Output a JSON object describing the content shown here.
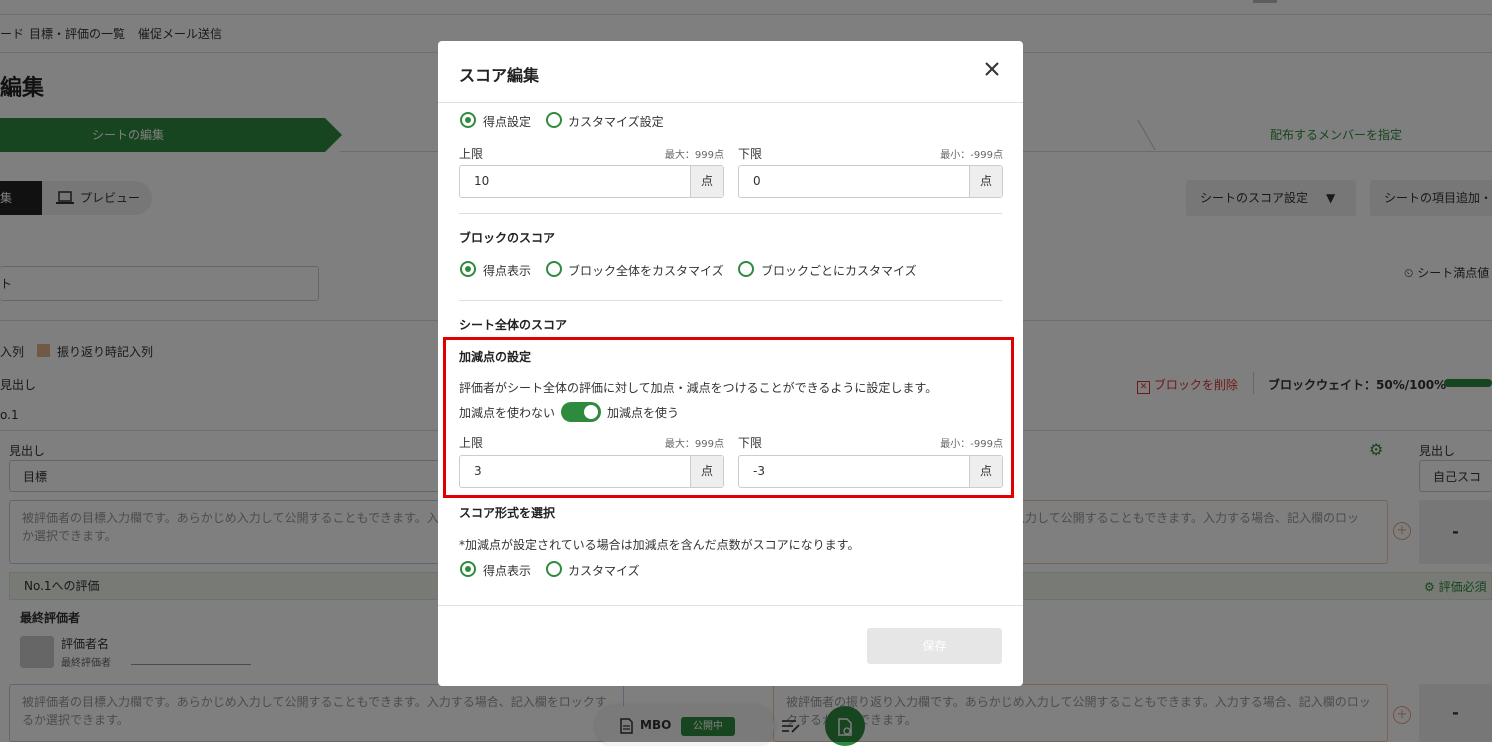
{
  "background": {
    "nav_items": [
      "ード",
      "目標・評価の一覧",
      "催促メール送信"
    ],
    "page_title": "編集",
    "steps": {
      "active": "シートの編集",
      "last": "配布するメンバーを指定"
    },
    "tabs": {
      "edit": "集",
      "preview": "プレビュー"
    },
    "buttons": {
      "score_settings": "シートのスコア設定",
      "add_items": "シートの項目追加・"
    },
    "input_fragment": "ト",
    "satisfy_label": "シート満点値",
    "legend": {
      "left": "入列",
      "reflection": "振り返り時記入列"
    },
    "heading_label": "見出し",
    "no1_label": "o.1",
    "delete_block": "ブロックを削除",
    "block_weight": "ブロックウェイト：50%/100%",
    "field_heading": "見出し",
    "field_goal": "目標",
    "field_heading_right": "見出し",
    "field_self_score": "自己スコア",
    "textarea_left": "被評価者の目標入力欄です。あらかじめ入力して公開することもできます。入力する場合、記入欄のロックるか選択できます。",
    "textarea_right": "入力して公開することもできます。入力する場合、記入欄のロッ",
    "dash": "-",
    "eval_band": "No.1への評価",
    "eval_required": "評価必須",
    "final_evaluator": "最終評価者",
    "evaluator_name": "評価者名",
    "evaluator_role": "最終評価者",
    "textarea_bottom_left": "被評価者の目標入力欄です。あらかじめ入力して公開することもできます。入力する場合、記入欄をロックするか選択できます。",
    "textarea_bottom_right": "被評価者の振り返り入力欄です。あらかじめ入力して公開することもできます。入力する場合、記入欄のロックするか選択できます。",
    "bottom_bar": {
      "label": "MBO",
      "status": "公開中"
    }
  },
  "modal": {
    "title": "スコア編集",
    "top_radios": {
      "options": [
        "得点設定",
        "カスタマイズ設定"
      ],
      "selected": 0
    },
    "range1": {
      "upper_label": "上限",
      "upper_hint": "最大：999点",
      "upper_value": "10",
      "unit": "点",
      "lower_label": "下限",
      "lower_hint": "最小：-999点",
      "lower_value": "0"
    },
    "block_score": {
      "title": "ブロックのスコア",
      "options": [
        "得点表示",
        "ブロック全体をカスタマイズ",
        "ブロックごとにカスタマイズ"
      ],
      "selected": 0
    },
    "sheet_score_title": "シート全体のスコア",
    "adjust": {
      "title": "加減点の設定",
      "description": "評価者がシート全体の評価に対して加点・減点をつけることができるように設定します。",
      "off_label": "加減点を使わない",
      "on_label": "加減点を使う",
      "enabled": true,
      "upper_label": "上限",
      "upper_hint": "最大：999点",
      "upper_value": "3",
      "unit": "点",
      "lower_label": "下限",
      "lower_hint": "最小：-999点",
      "lower_value": "-3"
    },
    "format": {
      "title": "スコア形式を選択",
      "note": "*加減点が設定されている場合は加減点を含んだ点数がスコアになります。",
      "options": [
        "得点表示",
        "カスタマイズ"
      ],
      "selected": 0
    },
    "save_label": "保存"
  },
  "colors": {
    "brand_green": "#2e8b3e",
    "highlight_red": "#e00000",
    "overlay": "rgba(0,0,0,0.5)"
  }
}
